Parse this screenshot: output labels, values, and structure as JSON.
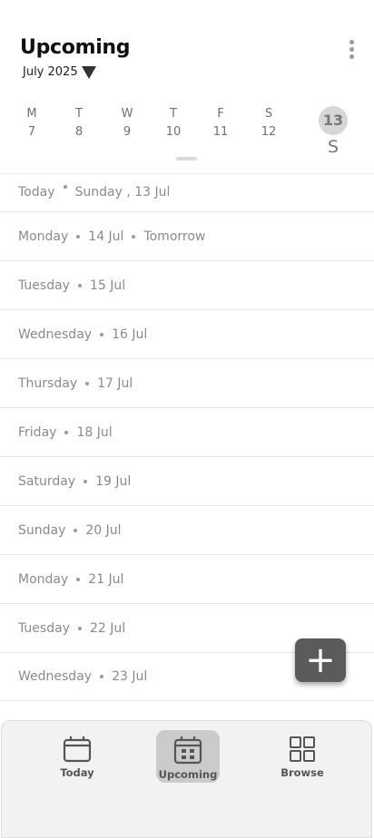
{
  "header": {
    "title": "Upcoming",
    "month": "July 2025"
  },
  "week": [
    {
      "letter": "M",
      "num": "7"
    },
    {
      "letter": "T",
      "num": "8"
    },
    {
      "letter": "W",
      "num": "9"
    },
    {
      "letter": "T",
      "num": "10"
    },
    {
      "letter": "F",
      "num": "11"
    },
    {
      "letter": "S",
      "num": "12"
    }
  ],
  "selected_day": {
    "num": "13",
    "letter": "S"
  },
  "days": [
    {
      "parts": [
        "Today",
        "Sunday , 13 Jul"
      ]
    },
    {
      "parts": [
        "Monday",
        "14 Jul",
        "Tomorrow"
      ]
    },
    {
      "parts": [
        "Tuesday",
        "15 Jul"
      ]
    },
    {
      "parts": [
        "Wednesday",
        "16 Jul"
      ]
    },
    {
      "parts": [
        "Thursday",
        "17 Jul"
      ]
    },
    {
      "parts": [
        "Friday",
        "18 Jul"
      ]
    },
    {
      "parts": [
        "Saturday",
        "19 Jul"
      ]
    },
    {
      "parts": [
        "Sunday",
        "20 Jul"
      ]
    },
    {
      "parts": [
        "Monday",
        "21 Jul"
      ]
    },
    {
      "parts": [
        "Tuesday",
        "22 Jul"
      ]
    },
    {
      "parts": [
        "Wednesday",
        "23 Jul"
      ]
    }
  ],
  "fab": {
    "icon": "plus-icon",
    "symbol": "+"
  },
  "nav": [
    {
      "label": "Today",
      "icon": "calendar-icon",
      "active": false
    },
    {
      "label": "Upcoming",
      "icon": "calendar-grid-icon",
      "active": true
    },
    {
      "label": "Browse",
      "icon": "grid-icon",
      "active": false
    }
  ]
}
